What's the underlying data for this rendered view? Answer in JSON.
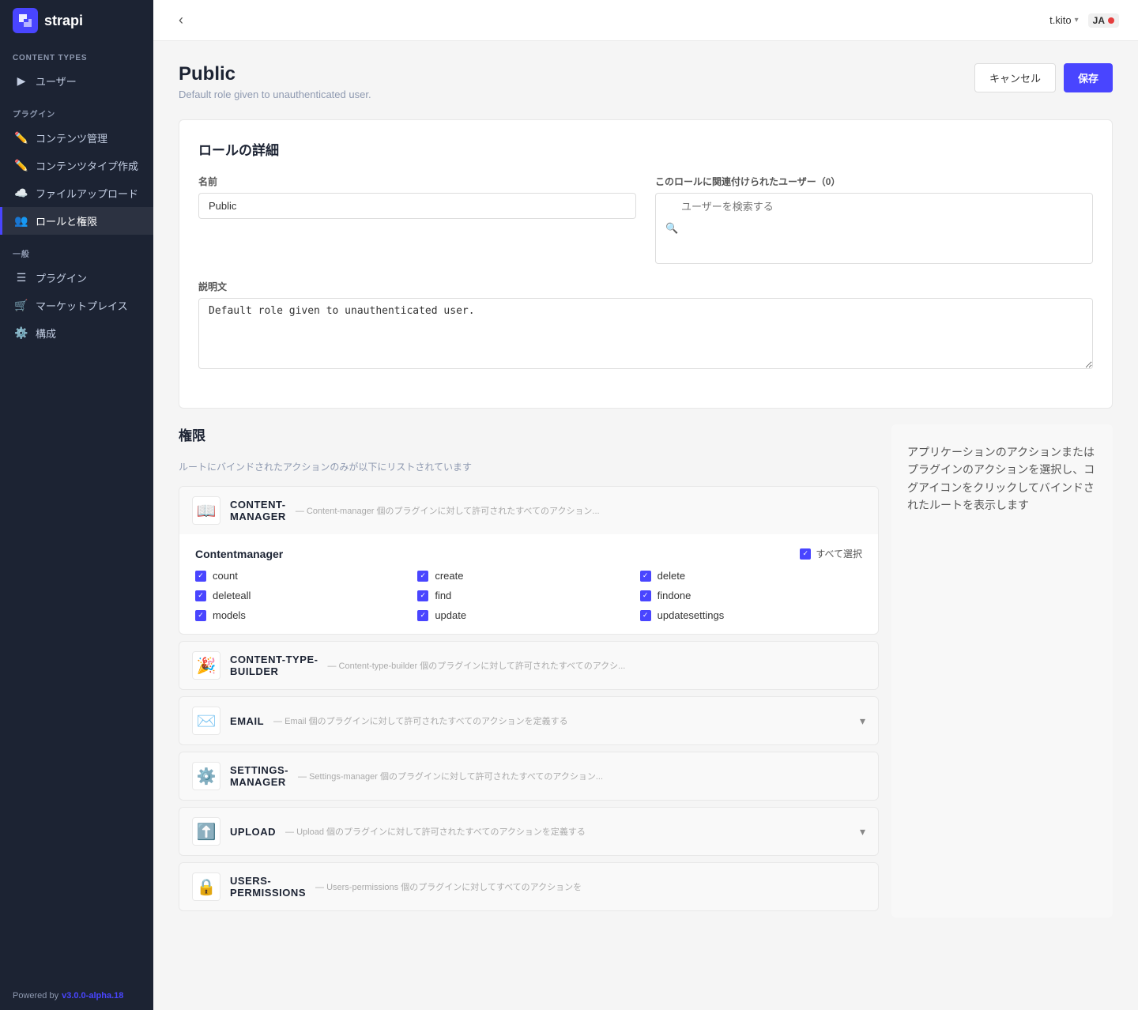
{
  "sidebar": {
    "logo_text": "strapi",
    "content_types_label": "CONTENT TYPES",
    "users_label": "ユーザー",
    "plugins_label": "プラグイン",
    "plugin_items": [
      {
        "label": "コンテンツ管理",
        "icon": "✏️"
      },
      {
        "label": "コンテンツタイプ作成",
        "icon": "✏️"
      },
      {
        "label": "ファイルアップロード",
        "icon": "☁️"
      },
      {
        "label": "ロールと権限",
        "icon": "👥",
        "active": true
      }
    ],
    "general_label": "一般",
    "general_items": [
      {
        "label": "プラグイン",
        "icon": "☰"
      },
      {
        "label": "マーケットプレイス",
        "icon": "🛒"
      },
      {
        "label": "構成",
        "icon": "⚙️"
      }
    ],
    "powered_by": "Powered by",
    "version": "v3.0.0-alpha.18"
  },
  "topbar": {
    "user": "t.kito",
    "lang": "JA"
  },
  "page": {
    "title": "Public",
    "subtitle": "Default role given to unauthenticated user.",
    "cancel_label": "キャンセル",
    "save_label": "保存"
  },
  "role_detail": {
    "section_title": "ロールの詳細",
    "name_label": "名前",
    "name_value": "Public",
    "description_label": "説明文",
    "description_value": "Default role given to unauthenticated user.",
    "users_label": "このロールに関連付けられたユーザー（0）",
    "user_search_placeholder": "ユーザーを検索する"
  },
  "permissions": {
    "title": "権限",
    "subtitle": "ルートにバインドされたアクションのみが以下にリストされています",
    "sidebar_text": "アプリケーションのアクションまたはプラグインのアクションを選択し、コグアイコンをクリックしてバインドされたルートを表示します",
    "plugins": [
      {
        "id": "content-manager",
        "emoji": "📖",
        "name_line1": "CONTENT-",
        "name_line2": "MANAGER",
        "desc": "— Content-manager 個のプラグインに対して許可されたすべてのアクション...",
        "expanded": true,
        "body_name": "Contentmanager",
        "select_all": "すべて選択",
        "permissions": [
          {
            "key": "count",
            "checked": true
          },
          {
            "key": "create",
            "checked": true
          },
          {
            "key": "delete",
            "checked": true
          },
          {
            "key": "deleteall",
            "checked": true
          },
          {
            "key": "find",
            "checked": true
          },
          {
            "key": "findone",
            "checked": true
          },
          {
            "key": "models",
            "checked": true
          },
          {
            "key": "update",
            "checked": true
          },
          {
            "key": "updatesettings",
            "checked": true
          }
        ]
      },
      {
        "id": "content-type-builder",
        "emoji": "🎉",
        "name_line1": "CONTENT-TYPE-",
        "name_line2": "BUILDER",
        "desc": "— Content-type-builder 個のプラグインに対して許可されたすべてのアクシ...",
        "expanded": false
      },
      {
        "id": "email",
        "emoji": "✉️",
        "name_line1": "EMAIL",
        "name_line2": "",
        "desc": "— Email 個のプラグインに対して許可されたすべてのアクションを定義する",
        "expanded": false
      },
      {
        "id": "settings-manager",
        "emoji": "⚙️",
        "name_line1": "SETTINGS-",
        "name_line2": "MANAGER",
        "desc": "— Settings-manager 個のプラグインに対して許可されたすべてのアクション...",
        "expanded": false
      },
      {
        "id": "upload",
        "emoji": "⬆️",
        "name_line1": "UPLOAD",
        "name_line2": "",
        "desc": "— Upload 個のプラグインに対して許可されたすべてのアクションを定義する",
        "expanded": false
      },
      {
        "id": "users-permissions",
        "emoji": "🔒",
        "name_line1": "USERS-",
        "name_line2": "PERMISSIONS",
        "desc": "— Users-permissions 個のプラグインに対してすべてのアクションを",
        "expanded": false
      }
    ]
  }
}
